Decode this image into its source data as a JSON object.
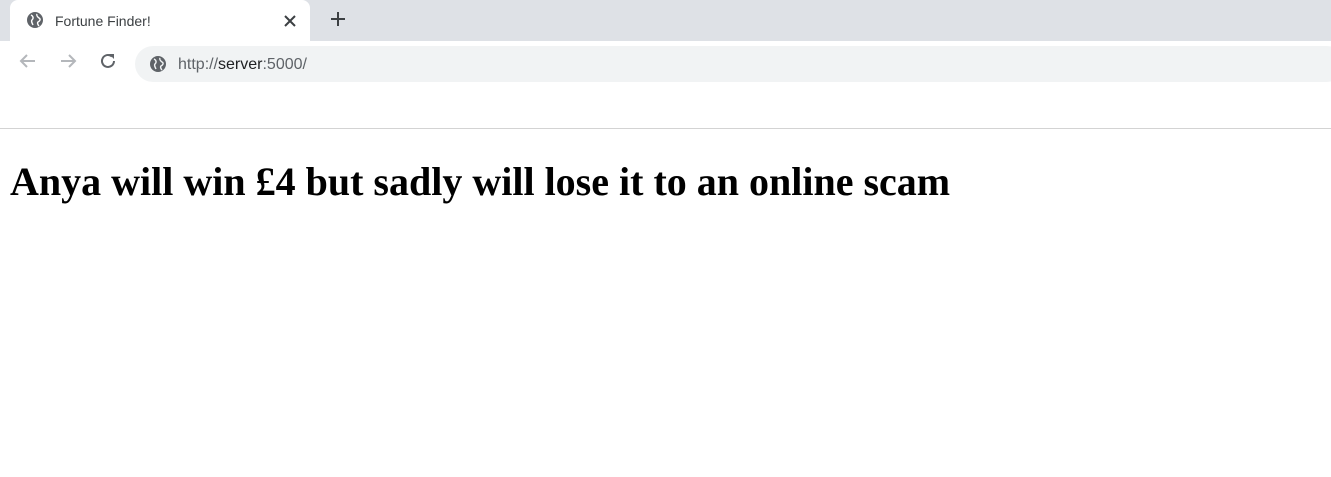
{
  "browser": {
    "tab": {
      "title": "Fortune Finder!",
      "favicon_icon": "globe-icon",
      "close_icon": "close-icon"
    },
    "new_tab_icon": "plus-icon",
    "nav": {
      "back_icon": "arrow-left-icon",
      "forward_icon": "arrow-right-icon",
      "reload_icon": "reload-icon"
    },
    "address_bar": {
      "icon": "globe-icon",
      "scheme": "http://",
      "host": "server",
      "rest": ":5000/"
    }
  },
  "page": {
    "heading": "Anya will win £4 but sadly will lose it to an online scam"
  },
  "colors": {
    "tabstrip_bg": "#dee1e6",
    "omnibox_bg": "#f1f3f4",
    "text_dark": "#202124"
  }
}
